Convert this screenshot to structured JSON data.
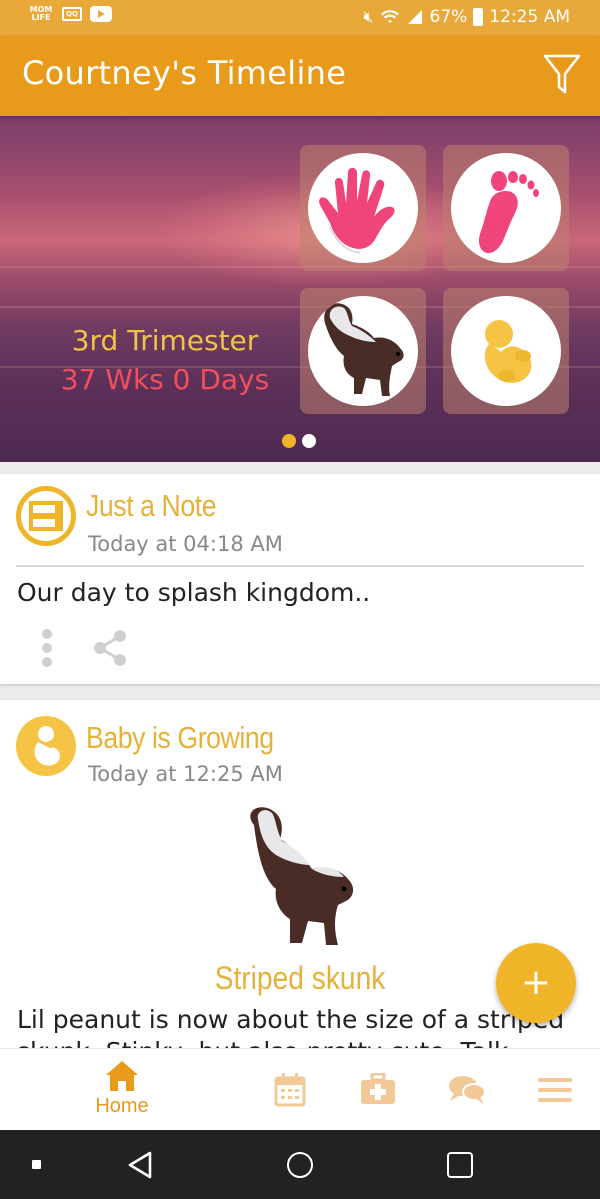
{
  "status_bar": {
    "app_logo": "MOM LIFE",
    "box_icon": "QQ",
    "battery": "67%",
    "time": "12:25 AM"
  },
  "app_bar": {
    "title": "Courtney's Timeline"
  },
  "hero": {
    "trimester": "3rd Trimester",
    "weeks": "37 Wks 0 Days",
    "tiles": [
      "hand-print-icon",
      "foot-print-icon",
      "skunk-image",
      "baby-fetus-icon"
    ],
    "page_dots": 2,
    "active_dot": 0,
    "colors": {
      "trimester": "#f0c24a",
      "weeks": "#f0505c",
      "pink": "#f0457a"
    }
  },
  "cards": [
    {
      "title": "Just a Note",
      "time": "Today at 04:18 AM",
      "body": "Our day to splash kingdom.."
    },
    {
      "title": "Baby is Growing",
      "time": "Today at 12:25 AM",
      "animal": "Striped skunk",
      "description": "Lil peanut is now about the size of a striped skunk. Stinky, but also pretty cute. Talk about"
    }
  ],
  "fab": {
    "label": "+"
  },
  "bottom_nav": {
    "home_label": "Home",
    "active": "home",
    "accent": "#e89a1a"
  }
}
